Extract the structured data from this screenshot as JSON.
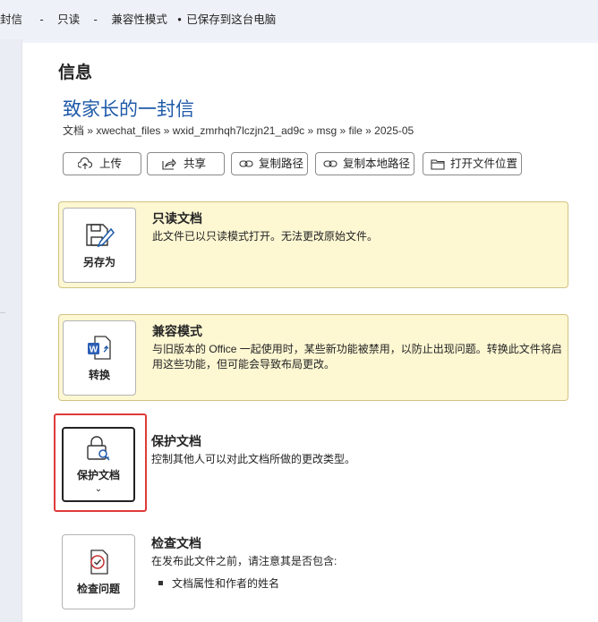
{
  "titlebar": {
    "segments": [
      "封信",
      "-",
      "只读",
      "-",
      "兼容性模式",
      "•",
      "已保存到这台电脑"
    ]
  },
  "info": {
    "heading": "信息",
    "doc_title": "致家长的一封信",
    "path": "文档 » xwechat_files » wxid_zmrhqh7lczjn21_ad9c » msg » file » 2025-05"
  },
  "actions": [
    {
      "label": "上传",
      "icon": "upload-icon"
    },
    {
      "label": "共享",
      "icon": "share-icon"
    },
    {
      "label": "复制路径",
      "icon": "link-icon"
    },
    {
      "label": "复制本地路径",
      "icon": "link-icon"
    },
    {
      "label": "打开文件位置",
      "icon": "folder-icon"
    }
  ],
  "sections": {
    "readonly": {
      "tile_label": "另存为",
      "icon": "save-as-icon",
      "title": "只读文档",
      "desc": "此文件已以只读模式打开。无法更改原始文件。"
    },
    "compat": {
      "tile_label": "转换",
      "icon": "word-convert-icon",
      "title": "兼容模式",
      "desc": "与旧版本的 Office 一起使用时，某些新功能被禁用，以防止出现问题。转换此文件将启用这些功能，但可能会导致布局更改。"
    },
    "protect": {
      "tile_label": "保护文档",
      "chevron": "⌄",
      "icon": "lock-key-icon",
      "title": "保护文档",
      "desc": "控制其他人可以对此文档所做的更改类型。"
    },
    "inspect": {
      "tile_label": "检查问题",
      "icon": "inspect-document-icon",
      "title": "检查文档",
      "desc": "在发布此文件之前，请注意其是否包含:",
      "bullet": "文档属性和作者的姓名"
    }
  },
  "colors": {
    "accent": "#1f5aa8",
    "warning_bg": "#fdf7d2",
    "highlight": "#e03a3a"
  }
}
